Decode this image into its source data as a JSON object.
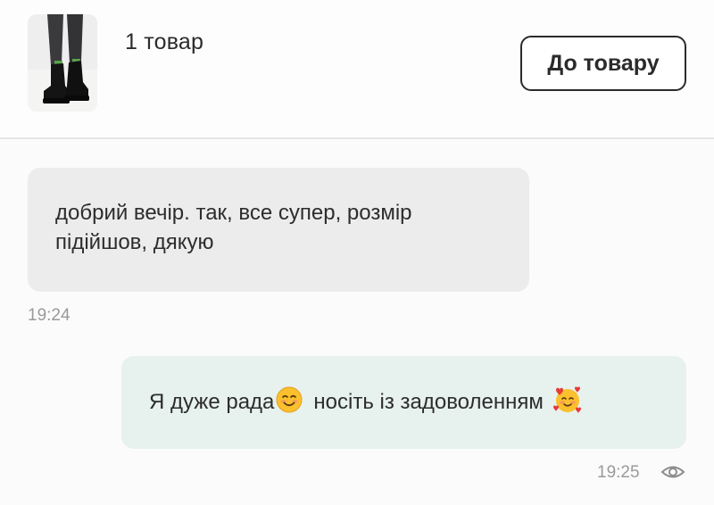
{
  "header": {
    "item_count": "1 товар",
    "go_to_product_label": "До товару",
    "thumbnail_icon": "product-boots-thumbnail"
  },
  "messages": [
    {
      "direction": "incoming",
      "text": "добрий вечір. так, все супер, розмір підійшов, дякую",
      "time": "19:24"
    },
    {
      "direction": "outgoing",
      "text_part1": "Я дуже рада",
      "emoji1": "smiling-face-emoji",
      "text_part2": "носіть із задоволенням",
      "emoji2": "smiling-face-with-hearts-emoji",
      "time": "19:25",
      "status_icon": "eye-icon"
    }
  ],
  "colors": {
    "incoming_bubble": "#ececec",
    "outgoing_bubble": "#e7f1ee",
    "text": "#2d2d2d",
    "timestamp": "#9a9a9a"
  }
}
